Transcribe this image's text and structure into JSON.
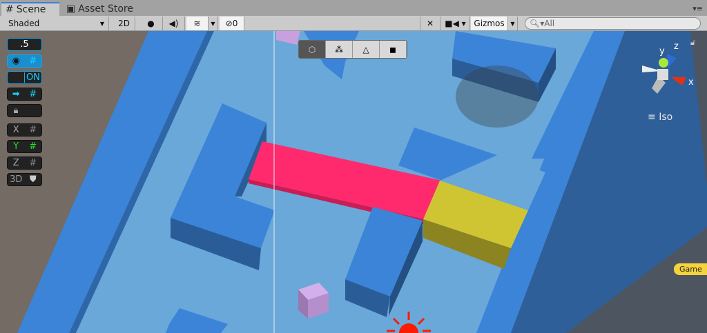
{
  "tabs": [
    {
      "label": "Scene",
      "icon": "grid-icon"
    },
    {
      "label": "Asset Store",
      "icon": "store-icon"
    }
  ],
  "toolbar": {
    "shading_mode": "Shaded",
    "mode_2d": "2D",
    "hidden_count": "0",
    "gizmos": "Gizmos",
    "search_placeholder": "All"
  },
  "left_tools": {
    "snap_value": ".5",
    "toggle": "ON",
    "x": "X",
    "y": "Y",
    "z": "Z",
    "d3": "3D"
  },
  "gizmo": {
    "x": "x",
    "y": "y",
    "z": "z",
    "projection": "Iso"
  },
  "game_label": "Game",
  "colors": {
    "floor": "#69a8d8",
    "wall": "#3b84d8",
    "pink": "#ff2a6d",
    "yellow": "#cfc533",
    "accent": "#3d7ed6"
  }
}
